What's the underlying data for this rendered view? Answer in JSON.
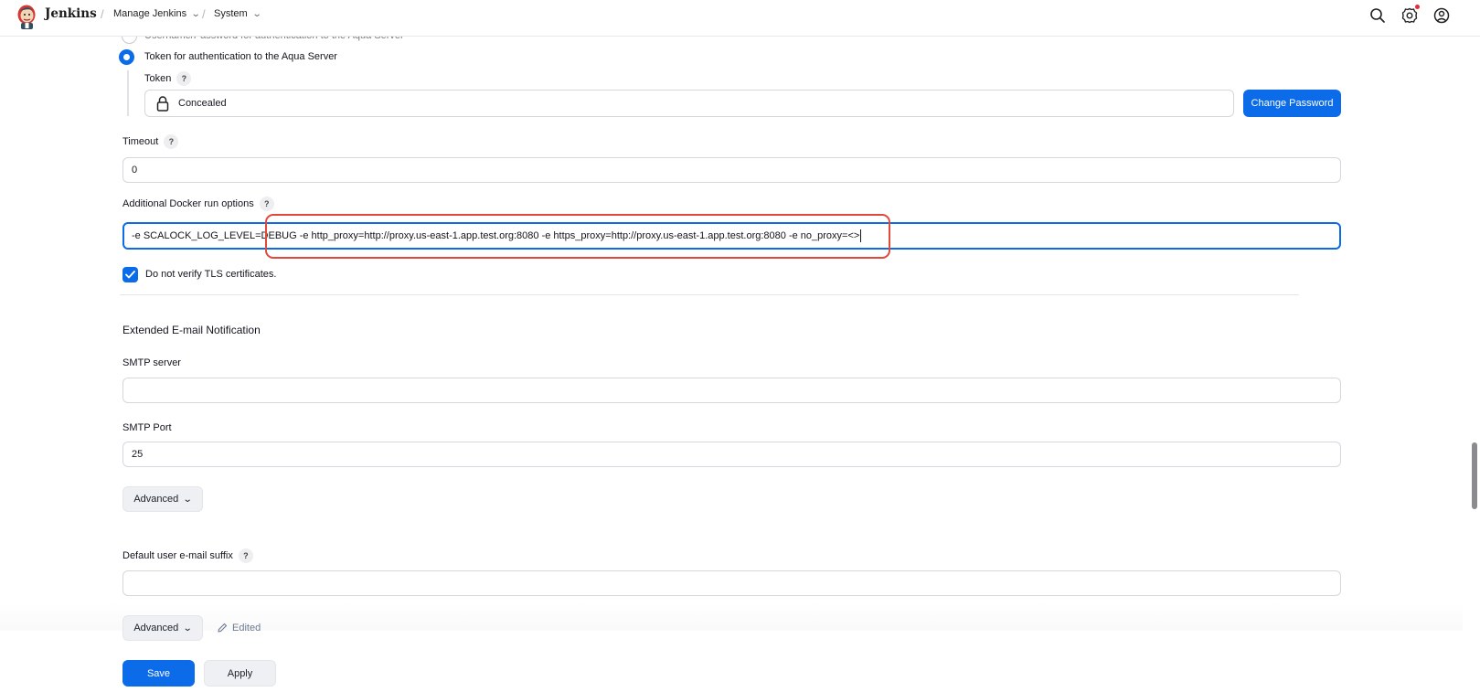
{
  "header": {
    "brand": "Jenkins",
    "breadcrumbs": [
      {
        "label": "Manage Jenkins"
      },
      {
        "label": "System"
      }
    ],
    "icons": [
      "search-icon",
      "gear-icon",
      "user-icon"
    ],
    "notification_color": "#e6283a"
  },
  "auth": {
    "hidden_option_label": "Username/Password for authentication to the Aqua Server",
    "token_option_label": "Token for authentication to the Aqua Server",
    "token_label": "Token",
    "token_value": "Concealed",
    "change_password_label": "Change Password"
  },
  "timeout": {
    "label": "Timeout",
    "value": "0"
  },
  "docker": {
    "label": "Additional Docker run options",
    "value": "-e SCALOCK_LOG_LEVEL=DEBUG -e http_proxy=http://proxy.us-east-1.app.test.org:8080 -e https_proxy=http://proxy.us-east-1.app.test.org:8080 -e no_proxy=<>",
    "highlight_color": "#df4a3d"
  },
  "tls": {
    "label": "Do not verify TLS certificates.",
    "checked": true
  },
  "email": {
    "section_title": "Extended E-mail Notification",
    "smtp_server_label": "SMTP server",
    "smtp_server_value": "",
    "smtp_port_label": "SMTP Port",
    "smtp_port_value": "25",
    "advanced_label": "Advanced",
    "default_suffix_label": "Default user e-mail suffix",
    "default_suffix_value": "",
    "advanced2_label": "Advanced",
    "edited_label": "Edited"
  },
  "footer": {
    "save_label": "Save",
    "apply_label": "Apply"
  },
  "colors": {
    "accent": "#0b6be8"
  }
}
